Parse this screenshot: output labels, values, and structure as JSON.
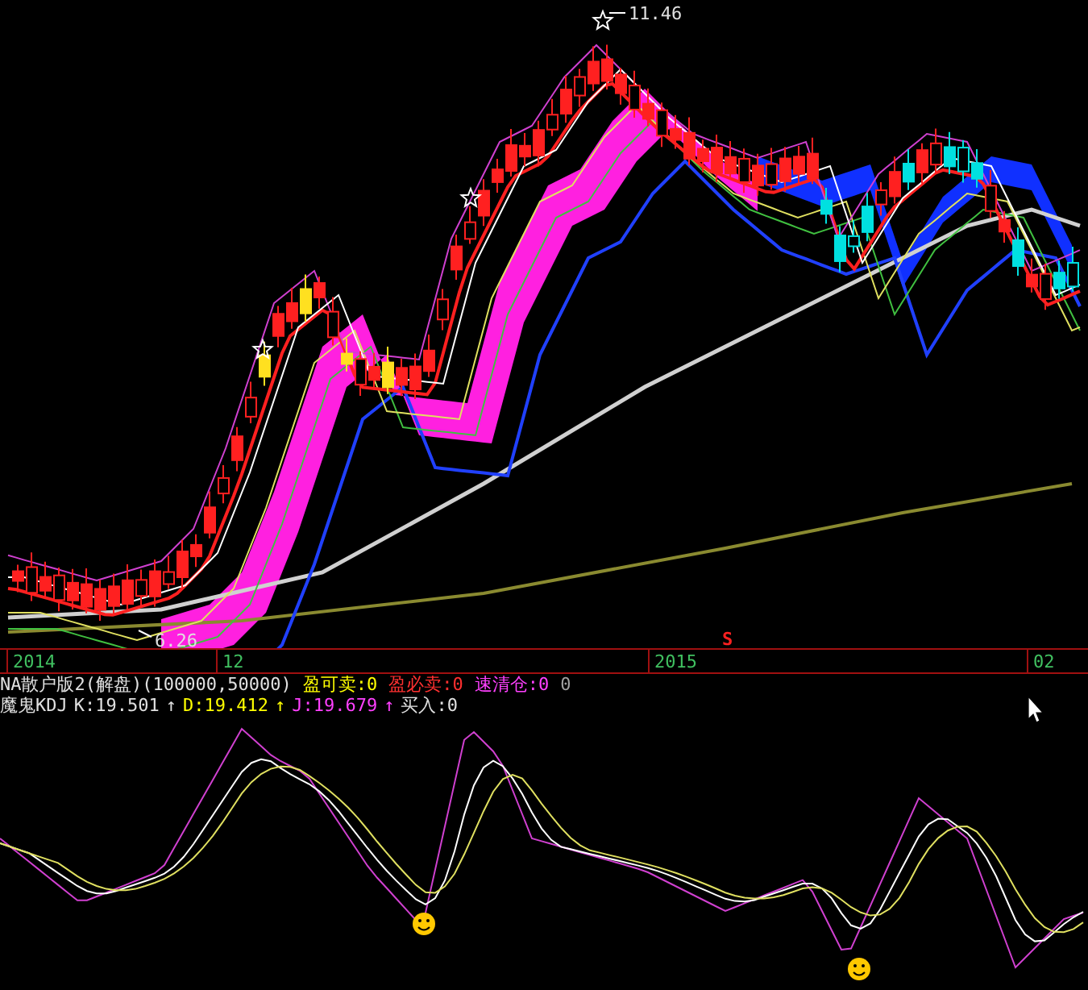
{
  "chart": {
    "high_label": "11.46",
    "low_label": "6.26",
    "signal_mark": "S"
  },
  "time_axis": [
    "2014",
    "12",
    "2015",
    "02"
  ],
  "indicator_1": {
    "name": "NA散户版2(解盘)(100000,50000)",
    "values": [
      {
        "text": "盈可卖:0",
        "color": "#ffff00"
      },
      {
        "text": "盈必卖:0",
        "color": "#ff3030"
      },
      {
        "text": "速清仓:0",
        "color": "#ff40ff"
      },
      {
        "text": "0",
        "color": "#a0a0a0"
      }
    ]
  },
  "indicator_2": {
    "values": [
      {
        "text": "魔鬼KDJ",
        "color": "#e0e0e0"
      },
      {
        "text": "K:19.501",
        "color": "#e0e0e0"
      },
      {
        "text": "↑",
        "color": "#e0e0e0"
      },
      {
        "text": "D:19.412",
        "color": "#ffff00"
      },
      {
        "text": "↑",
        "color": "#ffff00"
      },
      {
        "text": "J:19.679",
        "color": "#ff40ff"
      },
      {
        "text": "↑",
        "color": "#ff40ff"
      },
      {
        "text": "买入:0",
        "color": "#e0e0e0"
      }
    ]
  }
}
